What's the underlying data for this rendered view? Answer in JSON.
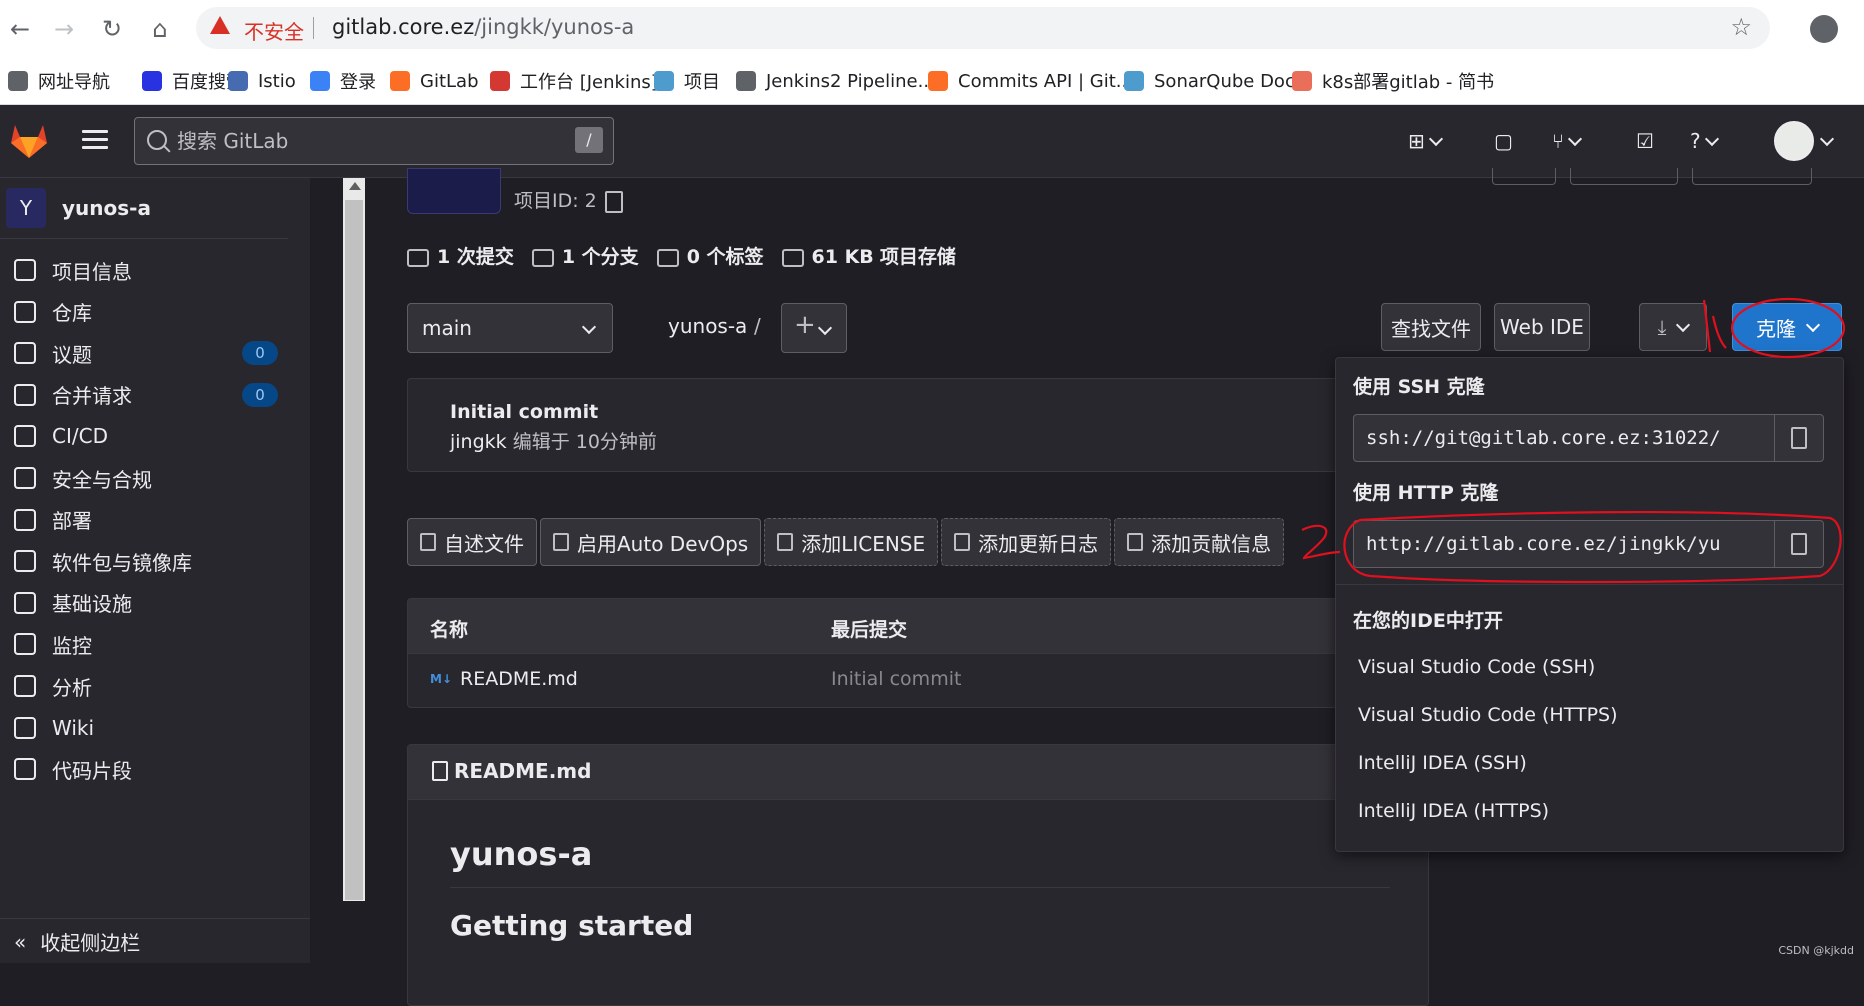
{
  "browser": {
    "url_warning": "不安全",
    "url_host": "gitlab.core.ez",
    "url_path": "/jingkk/yunos-a",
    "bookmarks": [
      {
        "label": "网址导航",
        "icon": "globe-icon",
        "color": "#5f6368"
      },
      {
        "label": "百度搜索",
        "icon": "baidu-paw-icon",
        "color": "#2932e1"
      },
      {
        "label": "Istio",
        "icon": "istio-sail-icon",
        "color": "#466bb0"
      },
      {
        "label": "登录",
        "icon": "login-icon",
        "color": "#3b82f6"
      },
      {
        "label": "GitLab",
        "icon": "gitlab-fox-icon",
        "color": "#fc6d26"
      },
      {
        "label": "工作台 [Jenkins]",
        "icon": "jenkins-icon",
        "color": "#d33833"
      },
      {
        "label": "项目",
        "icon": "sonar-wave-icon",
        "color": "#4e9bcd"
      },
      {
        "label": "Jenkins2 Pipeline...",
        "icon": "globe-icon",
        "color": "#5f6368"
      },
      {
        "label": "Commits API | Git...",
        "icon": "gitlab-fox-icon",
        "color": "#fc6d26"
      },
      {
        "label": "SonarQube Docs",
        "icon": "sonar-wave-icon",
        "color": "#4e9bcd"
      },
      {
        "label": "k8s部署gitlab - 简书",
        "icon": "jianshu-icon",
        "color": "#ea6f5a"
      }
    ]
  },
  "gitlab_header": {
    "search_placeholder": "搜索 GitLab",
    "search_shortcut": "/"
  },
  "sidebar": {
    "project_initial": "Y",
    "project_name": "yunos-a",
    "items": [
      {
        "label": "项目信息",
        "icon": "project-info-icon"
      },
      {
        "label": "仓库",
        "icon": "repository-icon"
      },
      {
        "label": "议题",
        "icon": "issues-icon",
        "badge": "0"
      },
      {
        "label": "合并请求",
        "icon": "merge-request-icon",
        "badge": "0"
      },
      {
        "label": "CI/CD",
        "icon": "rocket-icon"
      },
      {
        "label": "安全与合规",
        "icon": "shield-icon"
      },
      {
        "label": "部署",
        "icon": "deployments-icon"
      },
      {
        "label": "软件包与镜像库",
        "icon": "package-icon"
      },
      {
        "label": "基础设施",
        "icon": "infrastructure-icon"
      },
      {
        "label": "监控",
        "icon": "monitor-icon"
      },
      {
        "label": "分析",
        "icon": "analytics-icon"
      },
      {
        "label": "Wiki",
        "icon": "book-icon"
      },
      {
        "label": "代码片段",
        "icon": "snippet-scissors-icon"
      }
    ],
    "collapse_label": "收起侧边栏"
  },
  "project": {
    "project_id_label": "项目ID: 2",
    "stats": {
      "commits": "1 次提交",
      "branches": "1 个分支",
      "tags": "0 个标签",
      "storage_size": "61 KB",
      "storage_label": "项目存储"
    },
    "branch": "main",
    "breadcrumb": "yunos-a",
    "breadcrumb_sep": "/",
    "plus": "+",
    "find_file": "查找文件",
    "web_ide": "Web IDE",
    "clone": "克隆"
  },
  "last_commit": {
    "title": "Initial commit",
    "author": "jingkk",
    "meta": "编辑于 10分钟前"
  },
  "suggestions": [
    "自述文件",
    "启用Auto DevOps",
    "添加LICENSE",
    "添加更新日志",
    "添加贡献信息"
  ],
  "files": {
    "headers": {
      "name": "名称",
      "last_commit": "最后提交"
    },
    "rows": [
      {
        "name": "README.md",
        "type_label": "M↓",
        "commit": "Initial commit"
      }
    ]
  },
  "readme": {
    "file": "README.md",
    "h1": "yunos-a",
    "h2": "Getting started"
  },
  "clone_dropdown": {
    "ssh_label": "使用 SSH 克隆",
    "ssh_url": "ssh://git@gitlab.core.ez:31022/",
    "http_label": "使用 HTTP 克隆",
    "http_url": "http://gitlab.core.ez/jingkk/yu",
    "ide_label": "在您的IDE中打开",
    "ide_items": [
      "Visual Studio Code (SSH)",
      "Visual Studio Code (HTTPS)",
      "IntelliJ IDEA (SSH)",
      "IntelliJ IDEA (HTTPS)"
    ]
  },
  "watermark": "CSDN @kjkdd",
  "colors": {
    "primary": "#1f75cb",
    "annotation": "#e0101e",
    "badge_bg": "#064787"
  }
}
